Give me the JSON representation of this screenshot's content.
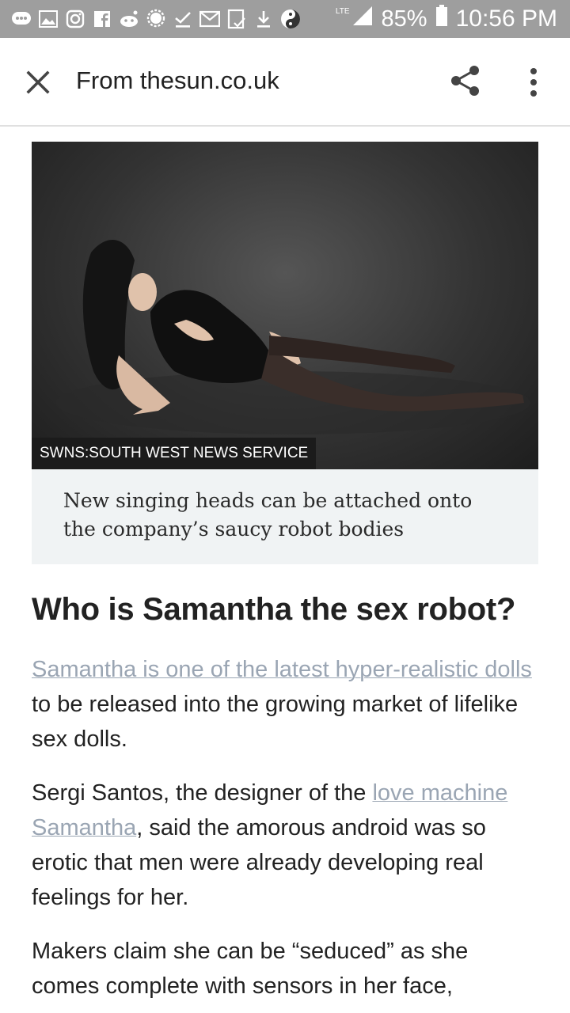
{
  "status_bar": {
    "network": "LTE",
    "battery": "85%",
    "time": "10:56 PM",
    "notification_icons": [
      "chat-icon",
      "image-icon",
      "instagram-icon",
      "facebook-icon",
      "reddit-icon",
      "message-icon",
      "check-icon",
      "gmail-icon",
      "clipboard-icon",
      "download-icon",
      "yin-yang-icon"
    ]
  },
  "toolbar": {
    "title": "From thesun.co.uk",
    "close_icon": "close-icon",
    "share_icon": "share-icon",
    "menu_icon": "more-vert-icon"
  },
  "image": {
    "credit": "SWNS:SOUTH WEST NEWS SERVICE",
    "caption": "New singing heads can be attached onto the company’s saucy robot bodies"
  },
  "article": {
    "headline": "Who is Samantha the sex robot?",
    "p1": {
      "link": "Samantha is one of the latest hyper-realistic dolls",
      "text": " to be released into the growing market of lifelike sex dolls."
    },
    "p2": {
      "before": "Sergi Santos, the designer of the ",
      "link": "love machine Samantha",
      "after": ", said the amorous android was so erotic that men were already developing real feelings for her."
    },
    "p3": {
      "text": "Makers claim she can be “seduced” as she comes complete with sensors in her face,"
    }
  },
  "colors": {
    "status_bar_bg": "#9e9e9e",
    "link": "#9aa5b3",
    "caption_bg": "#f0f3f4",
    "text": "#222222"
  }
}
